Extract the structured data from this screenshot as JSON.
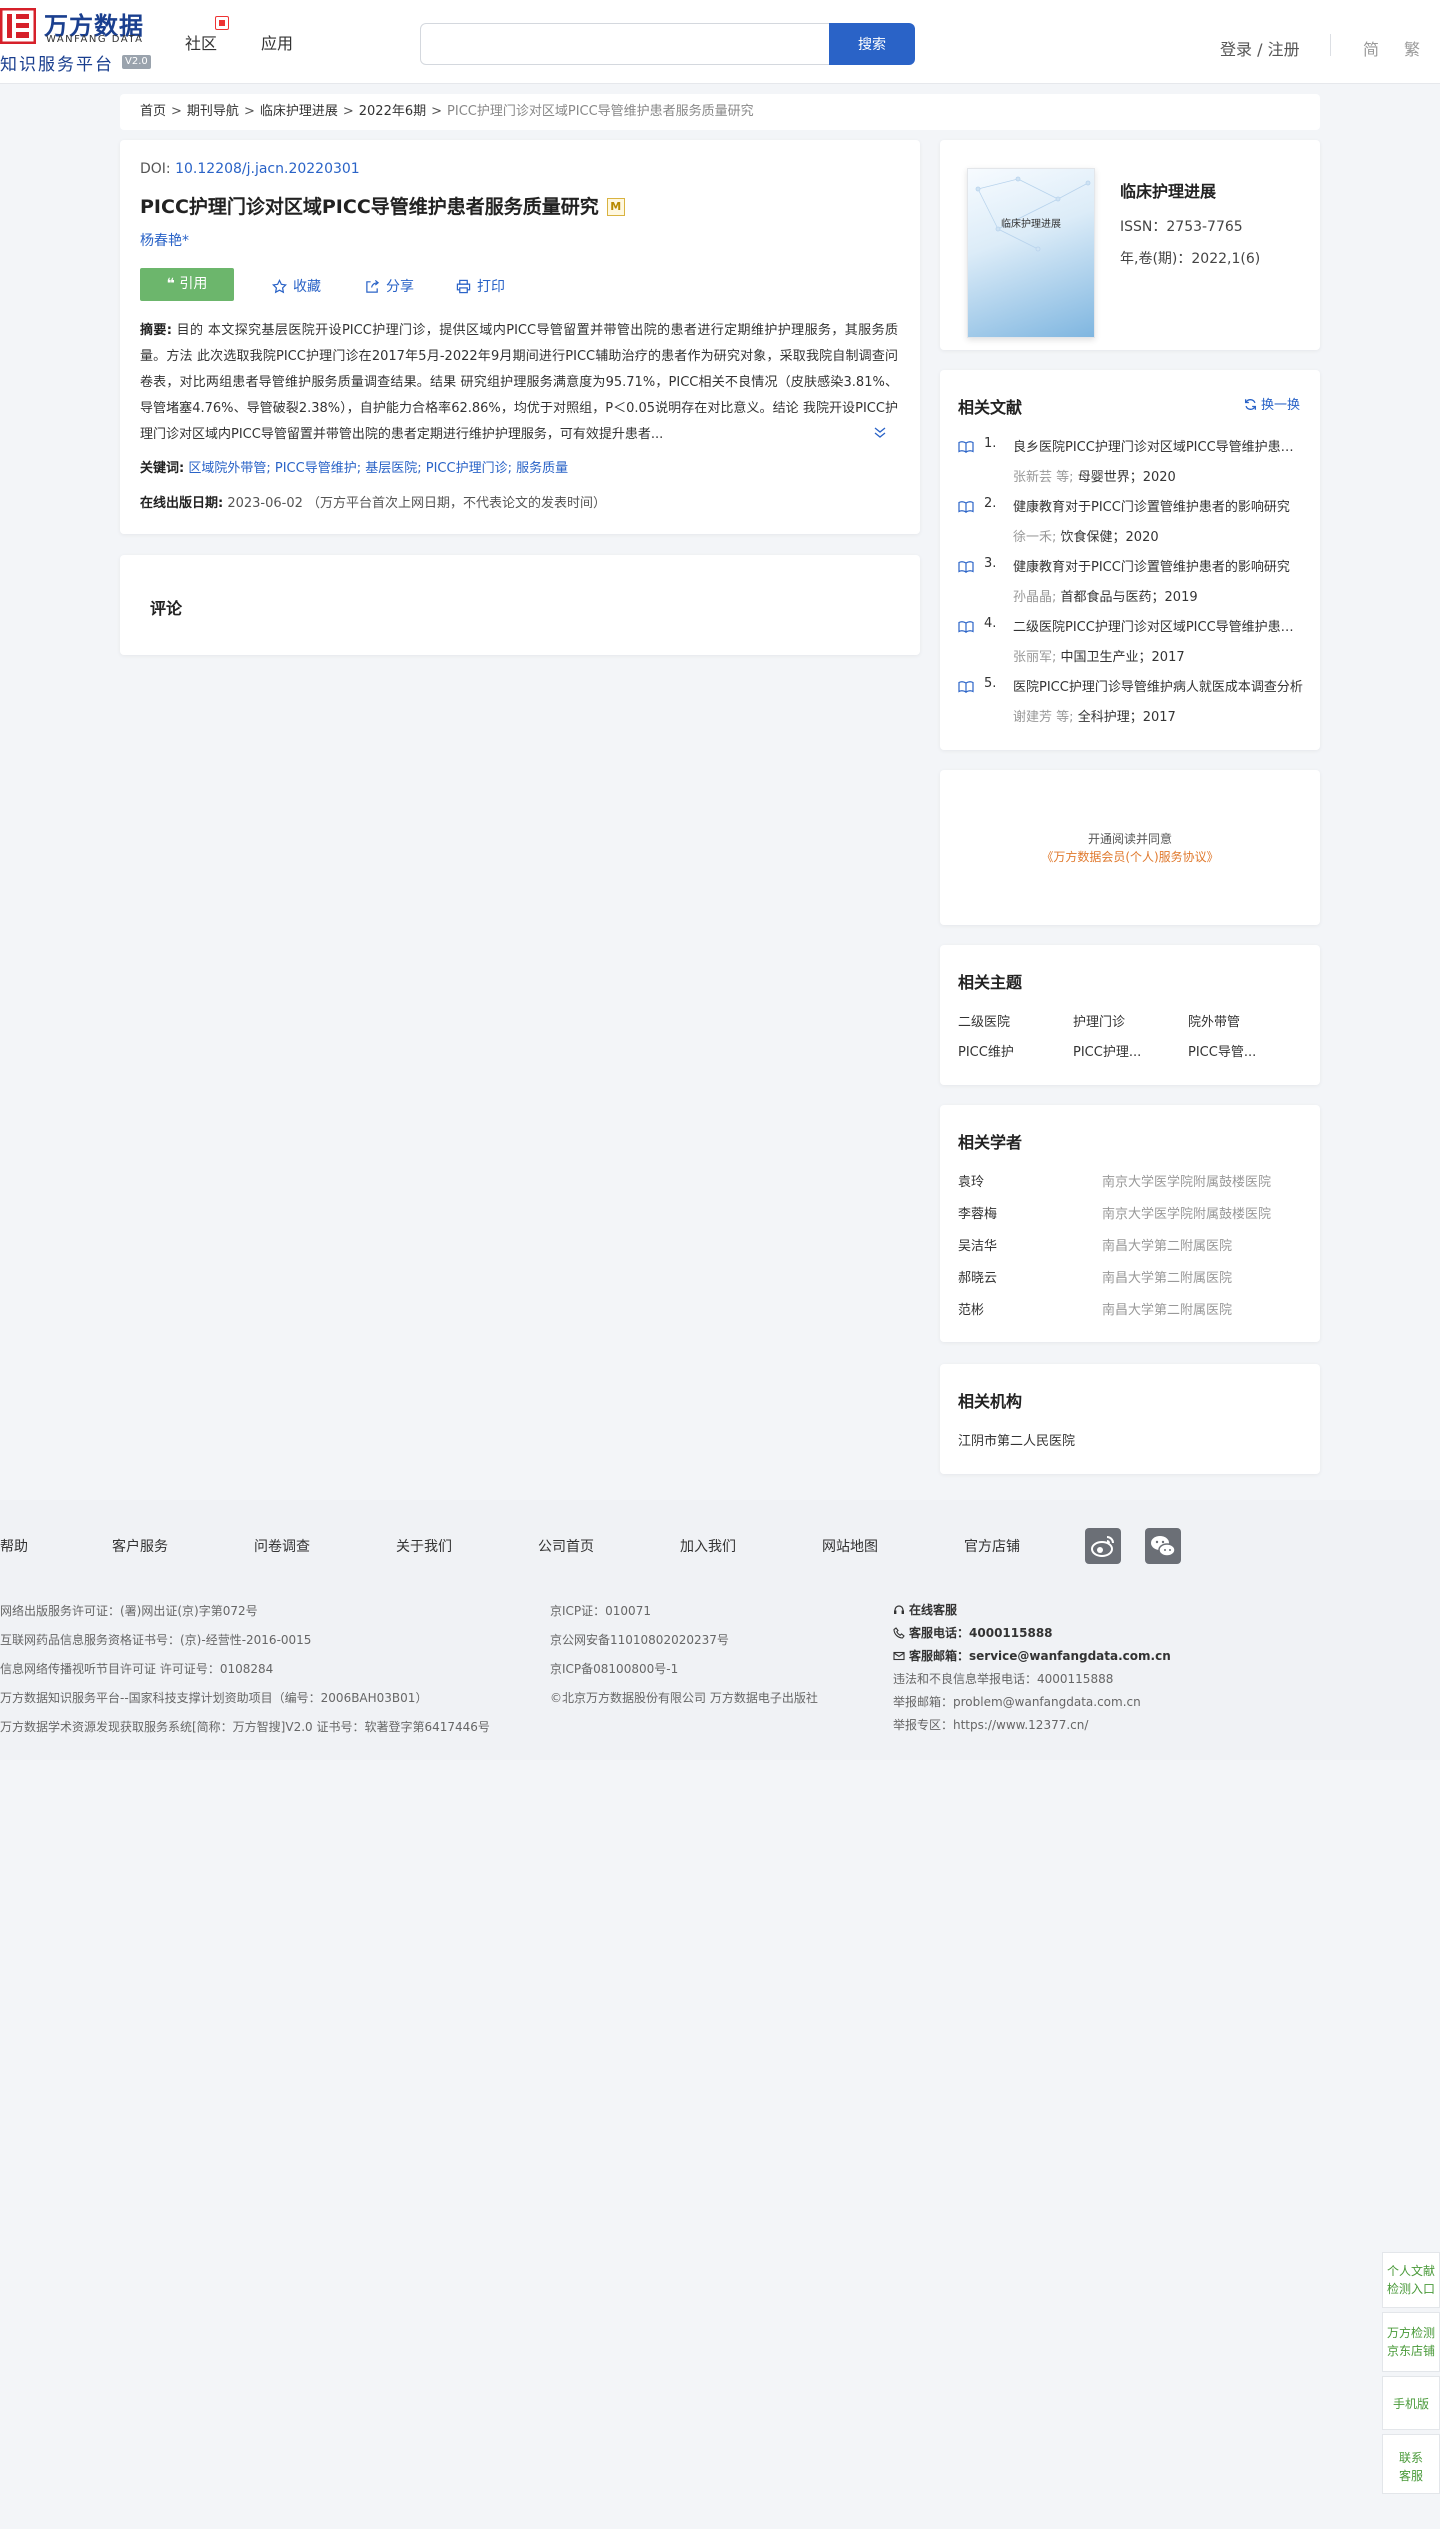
{
  "header": {
    "logo": {
      "cn": "万方数据",
      "en": "WANFANG DATA",
      "sub": "知识服务平台",
      "version": "V2.0"
    },
    "nav": {
      "community": "社区",
      "apps": "应用"
    },
    "search": {
      "placeholder": "",
      "button": "搜索"
    },
    "login": "登录 / 注册",
    "lang_simplified": "简",
    "lang_traditional": "繁"
  },
  "breadcrumb": [
    "首页",
    "期刊导航",
    "临床护理进展",
    "2022年6期",
    "PICC护理门诊对区域PICC导管维护患者服务质量研究"
  ],
  "article": {
    "doi_label": "DOI:",
    "doi": "10.12208/j.jacn.20220301",
    "title": "PICC护理门诊对区域PICC导管维护患者服务质量研究",
    "title_badge": "M",
    "author": "杨春艳*",
    "actions": {
      "cite": "引用",
      "favorite": "收藏",
      "share": "分享",
      "print": "打印"
    },
    "abstract_label": "摘要:",
    "abstract": "目的 本文探究基层医院开设PICC护理门诊，提供区域内PICC导管留置并带管出院的患者进行定期维护护理服务，其服务质量。方法 此次选取我院PICC护理门诊在2017年5月-2022年9月期间进行PICC辅助治疗的患者作为研究对象，采取我院自制调查问卷表，对比两组患者导管维护服务质量调查结果。结果 研究组护理服务满意度为95.71%，PICC相关不良情况（皮肤感染3.81%、导管堵塞4.76%、导管破裂2.38%），自护能力合格率62.86%，均优于对照组，P＜0.05说明存在对比意义。结论 我院开设PICC护理门诊对区域内PICC导管留置并带管出院的患者定期进行维护护理服务，可有效提升患者...",
    "keywords_label": "关键词:",
    "keywords": [
      "区域院外带管",
      "PICC导管维护",
      "基层医院",
      "PICC护理门诊",
      "服务质量"
    ],
    "pubdate_label": "在线出版日期:",
    "pubdate": "2023-06-02",
    "pubdate_note": "（万方平台首次上网日期，不代表论文的发表时间）"
  },
  "comments": {
    "title": "评论"
  },
  "journal": {
    "cover_text": "临床护理进展",
    "name": "临床护理进展",
    "issn": "ISSN：2753-7765",
    "volume": "年,卷(期)：2022,1(6)"
  },
  "related_docs": {
    "title": "相关文献",
    "swap": "换一换",
    "items": [
      {
        "num": "1.",
        "title": "良乡医院PICC护理门诊对区域PICC导管维护患者服务质量研究",
        "authors": "张新芸",
        "etal": "等;",
        "source": "母婴世界；2020"
      },
      {
        "num": "2.",
        "title": "健康教育对于PICC门诊置管维护患者的影响研究",
        "authors": "徐一禾;",
        "etal": "",
        "source": "饮食保健；2020"
      },
      {
        "num": "3.",
        "title": "健康教育对于PICC门诊置管维护患者的影响研究",
        "authors": "孙晶晶;",
        "etal": "",
        "source": "首都食品与医药；2019"
      },
      {
        "num": "4.",
        "title": "二级医院PICC护理门诊对区域PICC导管维护患者服务质量的影响",
        "authors": "张丽军;",
        "etal": "",
        "source": "中国卫生产业；2017"
      },
      {
        "num": "5.",
        "title": "医院PICC护理门诊导管维护病人就医成本调查分析",
        "authors": "谢建芳",
        "etal": "等;",
        "source": "全科护理；2017"
      }
    ]
  },
  "open_read": {
    "line1": "开通阅读并同意",
    "line2": "《万方数据会员(个人)服务协议》"
  },
  "topics": {
    "title": "相关主题",
    "items": [
      "二级医院",
      "护理门诊",
      "院外带管",
      "PICC维护",
      "PICC护理...",
      "PICC导管..."
    ]
  },
  "scholars": {
    "title": "相关学者",
    "items": [
      {
        "name": "袁玲",
        "org": "南京大学医学院附属鼓楼医院"
      },
      {
        "name": "李蓉梅",
        "org": "南京大学医学院附属鼓楼医院"
      },
      {
        "name": "吴洁华",
        "org": "南昌大学第二附属医院"
      },
      {
        "name": "郝晓云",
        "org": "南昌大学第二附属医院"
      },
      {
        "name": "范彬",
        "org": "南昌大学第二附属医院"
      }
    ]
  },
  "institutions": {
    "title": "相关机构",
    "items": [
      "江阴市第二人民医院"
    ]
  },
  "footer": {
    "links": [
      "帮助",
      "客户服务",
      "问卷调查",
      "关于我们",
      "公司首页",
      "加入我们",
      "网站地图",
      "官方店铺"
    ],
    "col1": [
      "网络出版服务许可证：(署)网出证(京)字第072号",
      "互联网药品信息服务资格证书号：(京)-经营性-2016-0015",
      "信息网络传播视听节目许可证 许可证号：0108284",
      "万方数据知识服务平台--国家科技支撑计划资助项目（编号：2006BAH03B01）",
      "万方数据学术资源发现获取服务系统[简称：万方智搜]V2.0 证书号：软著登字第6417446号"
    ],
    "col2": [
      "京ICP证：010071",
      "京公网安备11010802020237号",
      "京ICP备08100800号-1",
      "©北京万方数据股份有限公司 万方数据电子出版社"
    ],
    "online_service": "在线客服",
    "phone_label": "客服电话：",
    "phone": "4000115888",
    "email_label": "客服邮箱：",
    "email": "service@wanfangdata.com.cn",
    "report_phone": "违法和不良信息举报电话：4000115888",
    "report_email": "举报邮箱：problem@wanfangdata.com.cn",
    "report_zone": "举报专区：https://www.12377.cn/"
  },
  "float_sidebar": {
    "items": [
      {
        "l1": "个人文献",
        "l2": "检测入口"
      },
      {
        "l1": "万方检测",
        "l2": "京东店铺"
      },
      {
        "l1": "手机版",
        "l2": ""
      },
      {
        "l1": "联系",
        "l2": "客服"
      }
    ]
  },
  "colors": {
    "primary": "#2a63c7",
    "cite_green": "#6cb66c",
    "accent_orange": "#e0792d",
    "logo_red": "#d6202a"
  }
}
